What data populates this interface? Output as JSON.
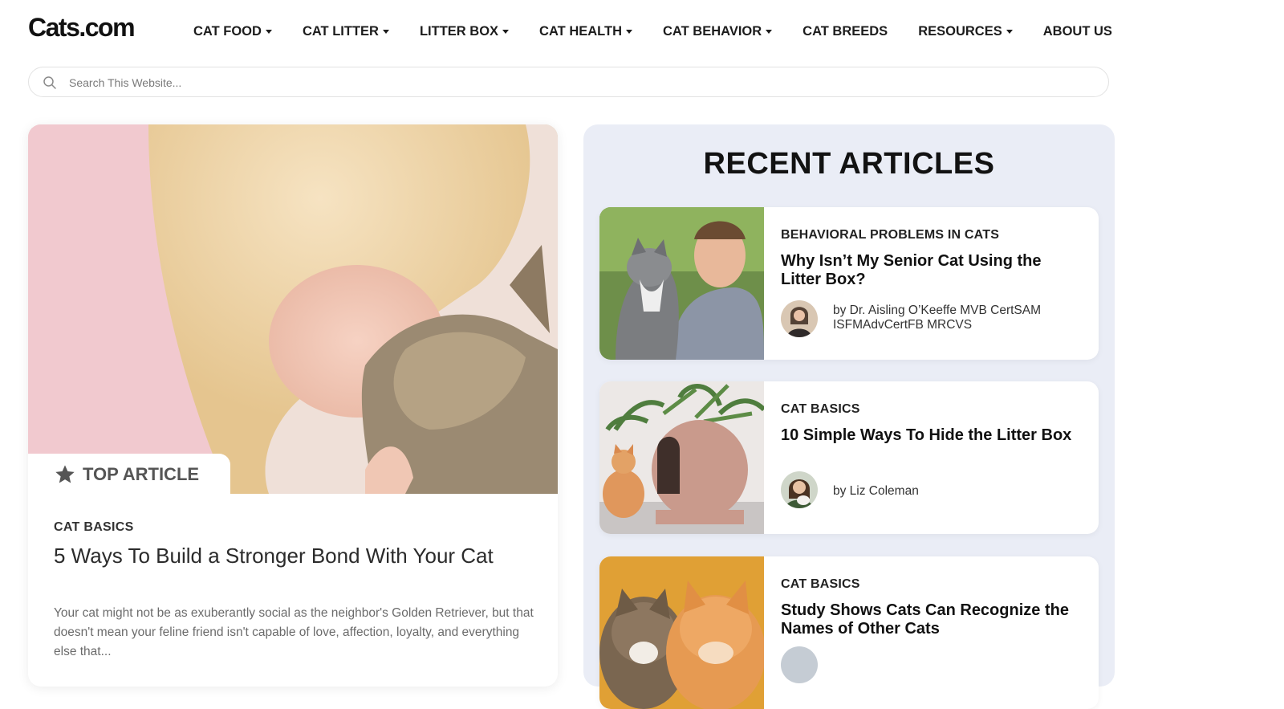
{
  "header": {
    "logo": "Cats.com",
    "nav": [
      {
        "label": "CAT FOOD",
        "dropdown": true
      },
      {
        "label": "CAT LITTER",
        "dropdown": true
      },
      {
        "label": "LITTER BOX",
        "dropdown": true
      },
      {
        "label": "CAT HEALTH",
        "dropdown": true
      },
      {
        "label": "CAT BEHAVIOR",
        "dropdown": true
      },
      {
        "label": "CAT BREEDS",
        "dropdown": false
      },
      {
        "label": "RESOURCES",
        "dropdown": true
      },
      {
        "label": "ABOUT US",
        "dropdown": false
      }
    ]
  },
  "search": {
    "placeholder": "Search This Website..."
  },
  "top_article": {
    "badge": "TOP ARTICLE",
    "category": "CAT BASICS",
    "title": "5 Ways To Build a Stronger Bond With Your Cat",
    "excerpt": "Your cat might not be as exuberantly social as the neighbor's Golden Retriever, but that doesn't mean your feline friend isn't capable of love, affection, loyalty, and everything else that..."
  },
  "recent": {
    "heading": "RECENT ARTICLES",
    "articles": [
      {
        "category": "BEHAVIORAL PROBLEMS IN CATS",
        "title": "Why Isn’t My Senior Cat Using the Litter Box?",
        "author": "by Dr. Aisling O’Keeffe MVB CertSAM ISFMAdvCertFB MRCVS"
      },
      {
        "category": "CAT BASICS",
        "title": "10 Simple Ways To Hide the Litter Box",
        "author": "by Liz Coleman"
      },
      {
        "category": "CAT BASICS",
        "title": "Study Shows Cats Can Recognize the Names of Other Cats",
        "author": ""
      }
    ]
  },
  "colors": {
    "recent_panel_bg": "#eaedf6",
    "text_dark": "#111111",
    "badge_text": "#555555"
  }
}
